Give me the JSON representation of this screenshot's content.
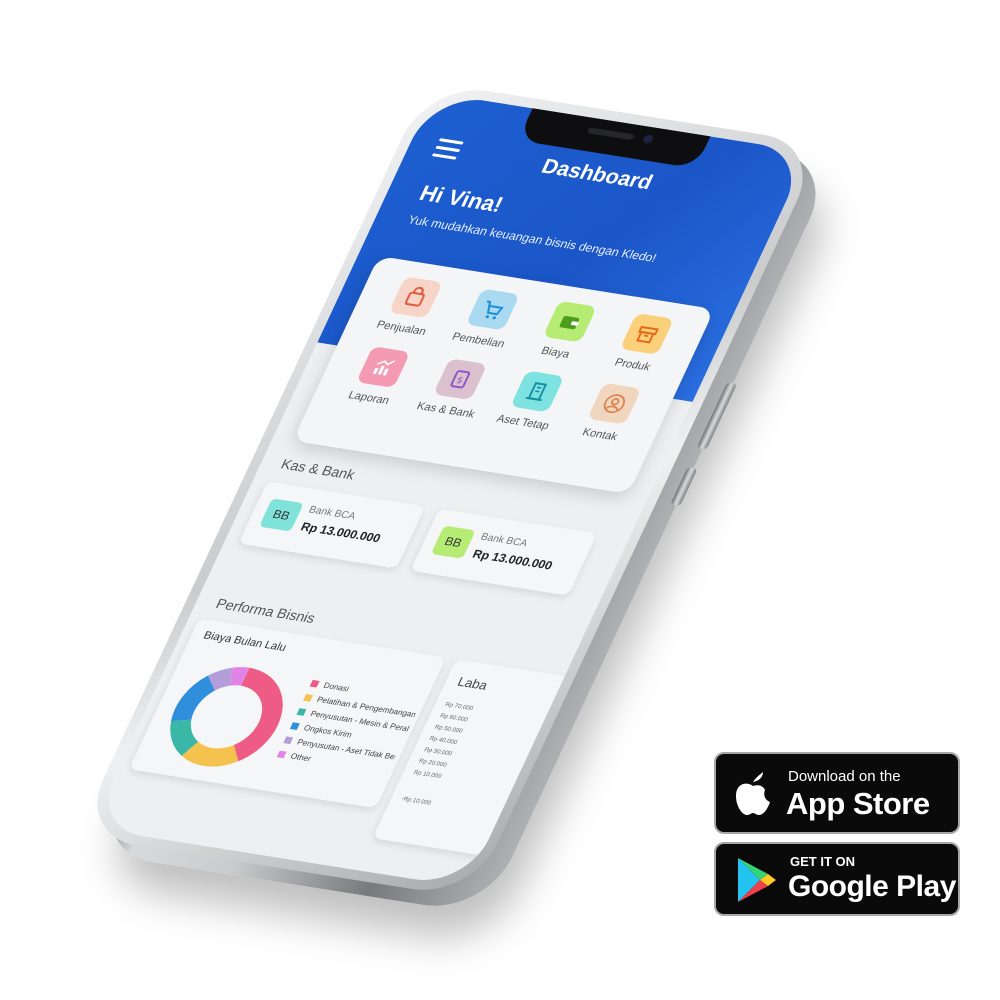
{
  "app": {
    "title": "Dashboard",
    "greeting": "Hi Vina!",
    "subgreeting": "Yuk mudahkan keuangan bisnis dengan Kledo!"
  },
  "menu": {
    "items": [
      {
        "label": "Penjualan",
        "icon": "shopping-bag-icon",
        "bg": "#f6d4c8",
        "color": "#e05a3b"
      },
      {
        "label": "Pembelian",
        "icon": "cart-icon",
        "bg": "#a9daf2",
        "color": "#1d8ed8"
      },
      {
        "label": "Biaya",
        "icon": "wallet-icon",
        "bg": "#b6ec74",
        "color": "#4e9c1b"
      },
      {
        "label": "Produk",
        "icon": "box-icon",
        "bg": "#fbd07a",
        "color": "#e56a1a"
      },
      {
        "label": "Laporan",
        "icon": "chart-icon",
        "bg": "#f49ab3",
        "color": "#ffffff"
      },
      {
        "label": "Kas & Bank",
        "icon": "cash-icon",
        "bg": "#dbc0cd",
        "color": "#8d55c8"
      },
      {
        "label": "Aset Tetap",
        "icon": "building-icon",
        "bg": "#7ee3e0",
        "color": "#1690a5"
      },
      {
        "label": "Kontak",
        "icon": "contact-icon",
        "bg": "#f0d6be",
        "color": "#dd8552"
      }
    ]
  },
  "kas_bank": {
    "title": "Kas & Bank",
    "accounts": [
      {
        "badge": "BB",
        "badge_color": "#7fe3d9",
        "name": "Bank BCA",
        "amount": "Rp 13.000.000"
      },
      {
        "badge": "BB",
        "badge_color": "#b6ec74",
        "name": "Bank BCA",
        "amount": "Rp 13.000.000"
      }
    ]
  },
  "performa": {
    "title": "Performa Bisnis",
    "biaya_card_title": "Biaya Bulan Lalu",
    "laba_card_title": "Laba",
    "laba_ticks": [
      "Rp 70.000",
      "Rp 60.000",
      "Rp 50.000",
      "Rp 40.000",
      "Rp 30.000",
      "Rp 20.000",
      "Rp 10.000",
      "-Rp 10.000"
    ]
  },
  "chart_data": {
    "type": "pie",
    "title": "Biaya Bulan Lalu",
    "categories": [
      "Donasi",
      "Pelatihan & Pengembangan",
      "Penyusutan - Mesin & Peralat",
      "Ongkos Kirim",
      "Penyusutan - Aset Tidak Ber",
      "Other"
    ],
    "values": [
      40,
      18,
      13,
      17,
      7,
      5
    ],
    "colors": [
      "#ee5b84",
      "#f5c24e",
      "#3ab7a6",
      "#2f8fdc",
      "#b49ed9",
      "#e283e6"
    ]
  },
  "stores": {
    "appstore_small": "Download on the",
    "appstore_big": "App Store",
    "googleplay_small": "GET IT ON",
    "googleplay_big": "Google Play"
  }
}
